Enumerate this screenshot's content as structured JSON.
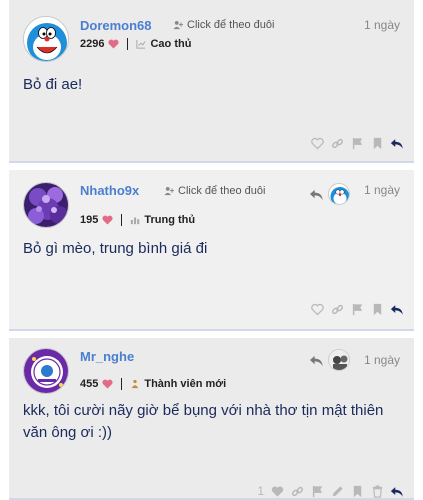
{
  "posts": [
    {
      "username": "Doremon68",
      "follow_label": "Click để theo đuôi",
      "date": "1 ngày",
      "likes": "2296",
      "rank": "Cao thủ",
      "body": "Bỏ đi ae!"
    },
    {
      "username": "Nhatho9x",
      "follow_label": "Click để theo đuôi",
      "date": "1 ngày",
      "likes": "195",
      "rank": "Trung thủ",
      "body": "Bỏ gì mèo, trung bình giá đi"
    },
    {
      "username": "Mr_nghe",
      "date": "1 ngày",
      "likes": "455",
      "rank": "Thành viên mới",
      "body": "kkk, tôi cười nãy giờ bể bụng với nhà thơ tịn mật thiên văn ông ơi :))",
      "like_count": "1"
    }
  ],
  "colors": {
    "username": "#4a7fd0",
    "heart": "#e36b86",
    "text": "#1b2a5c",
    "action_icon": "#b8b8b8",
    "reply_icon": "#1b2a5c"
  },
  "icons": [
    "user-plus-icon",
    "chart-icon",
    "heart-icon",
    "link-icon",
    "flag-icon",
    "bookmark-icon",
    "reply-icon",
    "edit-icon",
    "trash-icon",
    "reply-arrow-icon"
  ]
}
